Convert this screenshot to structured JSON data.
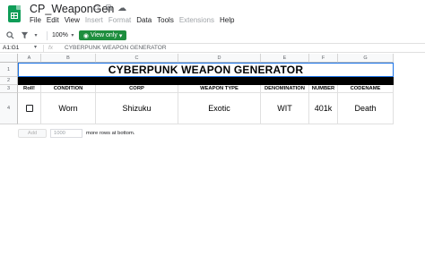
{
  "app": {
    "doc_title": "CP_WeaponGen",
    "menu": [
      {
        "label": "File",
        "enabled": true
      },
      {
        "label": "Edit",
        "enabled": true
      },
      {
        "label": "View",
        "enabled": true
      },
      {
        "label": "Insert",
        "enabled": false
      },
      {
        "label": "Format",
        "enabled": false
      },
      {
        "label": "Data",
        "enabled": true
      },
      {
        "label": "Tools",
        "enabled": true
      },
      {
        "label": "Extensions",
        "enabled": false
      },
      {
        "label": "Help",
        "enabled": true
      }
    ],
    "title_icons": [
      "star-icon",
      "move-folder-icon",
      "cloud-status-icon"
    ]
  },
  "toolbar": {
    "zoom": "100%",
    "view_only_label": "View only",
    "icons": [
      "search-icon",
      "filter-icon"
    ]
  },
  "formula_bar": {
    "name_box": "A1:G1",
    "fx": "fx",
    "content": "CYBERPUNK WEAPON GENERATOR"
  },
  "sheet": {
    "columns": [
      "A",
      "B",
      "C",
      "D",
      "E",
      "F",
      "G"
    ],
    "rows": [
      "1",
      "2",
      "3",
      "4"
    ],
    "banner": "CYBERPUNK WEAPON GENERATOR",
    "headers": [
      "Roll!",
      "CONDITION",
      "CORP",
      "WEAPON TYPE",
      "DENOMINATION",
      "NUMBER",
      "CODENAME"
    ],
    "values": [
      "",
      "Worn",
      "Shizuku",
      "Exotic",
      "WIT",
      "401k",
      "Death"
    ],
    "roll_checked": false
  },
  "add_rows": {
    "button_label": "Add",
    "count": "1000",
    "suffix": "more rows at bottom."
  },
  "colors": {
    "brand_green": "#0f9d58",
    "view_only_bg": "#1e8e3e",
    "selection_blue": "#1a73e8"
  }
}
